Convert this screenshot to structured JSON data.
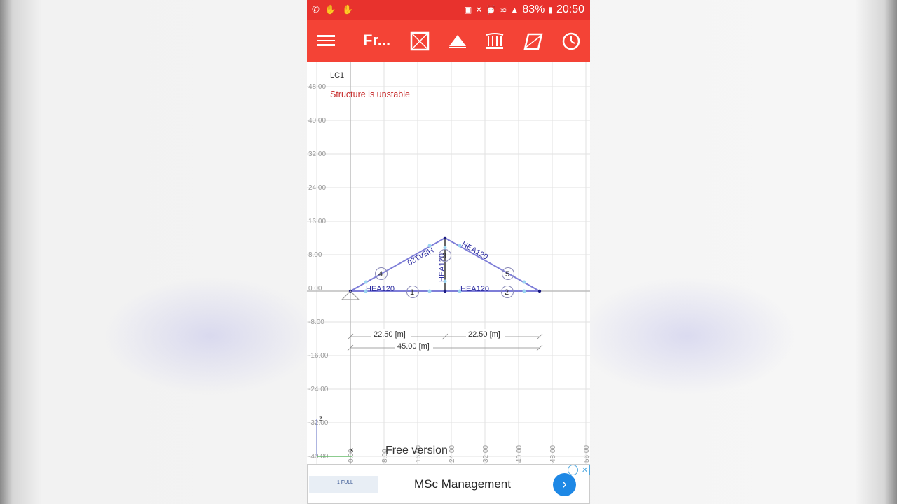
{
  "status_bar": {
    "battery": "83%",
    "time": "20:50",
    "icons": [
      "whatsapp-icon",
      "hand-icon",
      "hand-icon",
      "nfc-icon",
      "mute-icon",
      "alarm-icon",
      "wifi-icon",
      "signal-icon",
      "battery-icon"
    ]
  },
  "app_bar": {
    "title": "Fr...",
    "tools": [
      "frame-icon",
      "support-icon",
      "loads-icon",
      "section-icon",
      "history-icon"
    ]
  },
  "canvas": {
    "load_case": "LC1",
    "warning": "Structure is unstable",
    "y_ticks": [
      "48.00",
      "40.00",
      "32.00",
      "24.00",
      "16.00",
      "8.00",
      "0.00",
      "-8.00",
      "-16.00",
      "-24.00",
      "-32.00",
      "-40.00"
    ],
    "x_ticks": [
      "0.00",
      "8.00",
      "16.00",
      "24.00",
      "32.00",
      "40.00",
      "48.00",
      "56.00"
    ],
    "members": [
      {
        "label": "HEA120",
        "id": "1"
      },
      {
        "label": "HEA120",
        "id": "2"
      },
      {
        "label": "HEA120",
        "id": "3"
      },
      {
        "label": "HEA120",
        "id": "4"
      },
      {
        "label": "HEA120",
        "id": "5"
      }
    ],
    "dimensions": {
      "left_span": "22.50 [m]",
      "right_span": "22.50 [m]",
      "total_span": "45.00 [m]"
    },
    "axis_z": "z",
    "axis_x": "x",
    "free_version": "Free version"
  },
  "ad": {
    "text": "MSc Management",
    "thumb_text": "1 FULL"
  }
}
